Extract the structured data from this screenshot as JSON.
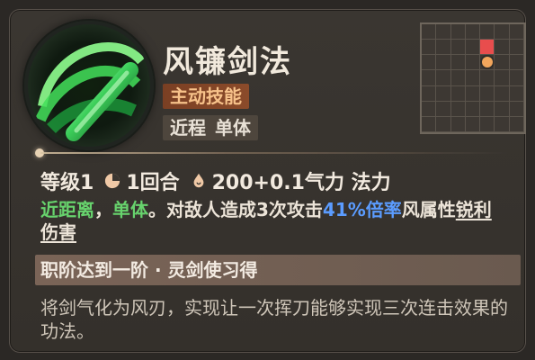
{
  "skill": {
    "name": "风镰剑法",
    "type_label": "主动技能",
    "range": "近程",
    "target": "单体"
  },
  "grid": {
    "rows": 7,
    "cols": 7,
    "highlight_red": [
      1,
      4
    ],
    "user_position": [
      2,
      4
    ]
  },
  "stats": {
    "level": "等级1",
    "cooldown": "1回合",
    "cost": "200+0.1气力 法力"
  },
  "description": {
    "part1": "近距离",
    "part2": "，",
    "part3": "单体",
    "part4": "。对敌人造成3次攻击",
    "part5": "41%倍率",
    "part6": "风属性",
    "part7": "锐利伤害"
  },
  "requirement": "职阶达到一阶 · 灵剑使习得",
  "lore": "将剑气化为风刃，实现让一次挥刀能够实现三次连击效果的功法。",
  "colors": {
    "red_cell": "#e84d4d",
    "dot": "#f2a65c",
    "green_text": "#67d36d",
    "blue_text": "#5b9cff",
    "skill_type_bg": "#8b4b2a"
  }
}
